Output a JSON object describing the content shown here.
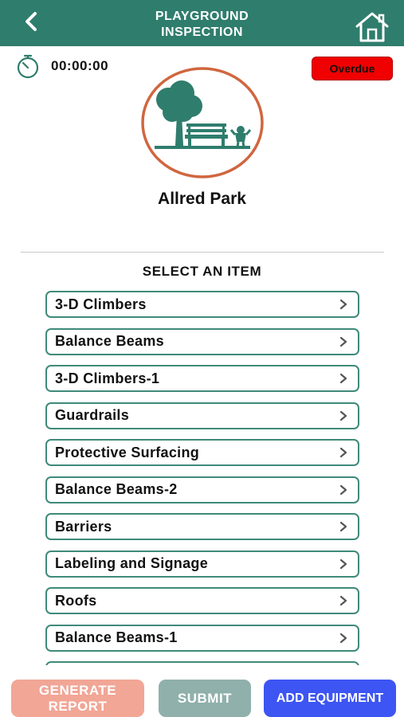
{
  "header": {
    "title_line1": "PLAYGROUND",
    "title_line2": "INSPECTION",
    "back_icon": "chevron-left-icon",
    "home_icon": "home-icon"
  },
  "timer": {
    "icon": "stopwatch-icon",
    "value": "00:00:00"
  },
  "status": {
    "label": "Overdue",
    "color": "#f00000"
  },
  "park": {
    "logo_icon": "park-tree-bench-icon",
    "name": "Allred Park"
  },
  "list": {
    "title": "SELECT AN ITEM",
    "items": [
      {
        "label": "3-D Climbers"
      },
      {
        "label": "Balance Beams"
      },
      {
        "label": "3-D Climbers-1"
      },
      {
        "label": "Guardrails"
      },
      {
        "label": "Protective Surfacing"
      },
      {
        "label": "Balance Beams-2"
      },
      {
        "label": "Barriers"
      },
      {
        "label": "Labeling and Signage"
      },
      {
        "label": "Roofs"
      },
      {
        "label": "Balance Beams-1"
      },
      {
        "label": ""
      }
    ]
  },
  "footer": {
    "generate_line1": "GENERATE",
    "generate_line2": "REPORT",
    "submit": "SUBMIT",
    "add_equipment": "ADD EQUIPMENT"
  },
  "colors": {
    "header": "#2f7d6d",
    "item_border": "#3f8a7a",
    "logo_ring": "#d0663f",
    "generate": "#f1a696",
    "submit": "#8fb0ab",
    "add_equipment": "#3d55f2"
  }
}
